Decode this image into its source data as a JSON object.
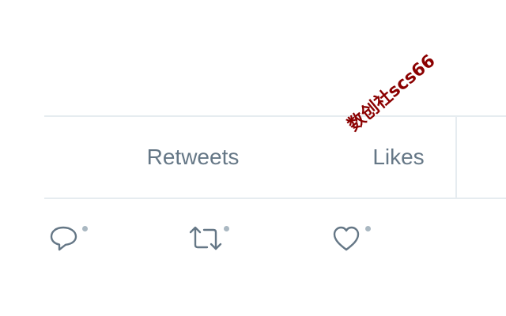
{
  "stats": {
    "retweets_label": "Retweets",
    "likes_label": "Likes"
  },
  "watermark": {
    "text": "数创社scs66"
  },
  "actions": {
    "reply_icon": "reply-icon",
    "retweet_icon": "retweet-icon",
    "like_icon": "like-icon"
  },
  "colors": {
    "icon": "#657786",
    "border": "#e6ecf0",
    "dot": "#aab8c2",
    "watermark": "#8b0000"
  }
}
